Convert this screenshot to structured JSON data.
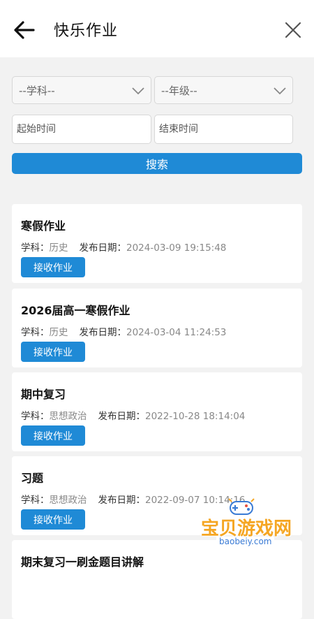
{
  "header": {
    "title": "快乐作业"
  },
  "filters": {
    "subject": "--学科--",
    "grade": "--年级--",
    "start_placeholder": "起始时间",
    "end_placeholder": "结束时间",
    "search_label": "搜索"
  },
  "labels": {
    "subject": "学科：",
    "date": "发布日期：",
    "receive": "接收作业"
  },
  "cards": [
    {
      "name": "寒假作业",
      "subject": "历史",
      "date": "2024-03-09 19:15:48"
    },
    {
      "name": "2026届高一寒假作业",
      "subject": "历史",
      "date": "2024-03-04 11:24:53"
    },
    {
      "name": "期中复习",
      "subject": "思想政治",
      "date": "2022-10-28 18:14:04"
    },
    {
      "name": "习题",
      "subject": "思想政治",
      "date": "2022-09-07 10:14:16"
    },
    {
      "name": "期末复习一刷金题目讲解"
    }
  ],
  "watermark": {
    "title": "宝贝游戏网",
    "url": "baobeiy.com"
  }
}
